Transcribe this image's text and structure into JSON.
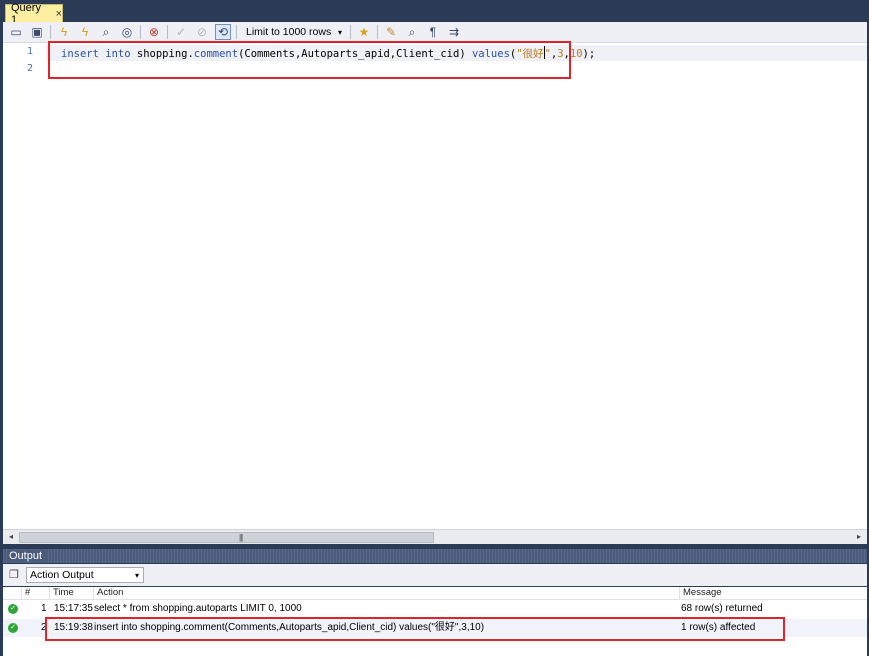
{
  "tab": {
    "title": "Query 1",
    "close": "×"
  },
  "toolbar": {
    "buttons": [
      "open-file-icon",
      "save-icon",
      "execute-icon",
      "execute-current-icon",
      "explain-icon",
      "stop-icon",
      "toggle-error-icon",
      "commit-icon",
      "rollback-icon",
      "autocommit-icon",
      "beautify-icon",
      "find-icon",
      "invisible-chars-icon",
      "wrap-icon",
      "snippet-icon"
    ],
    "limit_label": "Limit to 1000 rows",
    "limit_arrow": "▾"
  },
  "editor": {
    "line_numbers": [
      "1",
      "2"
    ],
    "line1": {
      "t1": "insert",
      "t2": "into",
      "t3": "shopping.",
      "t4": "comment",
      "t5": "(Comments,Autoparts_apid,Client_cid) ",
      "t6": "values",
      "t7": "(",
      "t8": "\"很好",
      "t9": "\"",
      "t10": ",",
      "t11": "3",
      "t12": ",",
      "t13": "10",
      "t14": ");"
    }
  },
  "scrollbar": {
    "left_arrow": "◂",
    "right_arrow": "▸",
    "grip": "|||"
  },
  "output": {
    "title": "Output",
    "view_select": "Action Output",
    "view_arrow": "▾",
    "columns": [
      "#",
      "Time",
      "Action",
      "Message"
    ],
    "rows": [
      {
        "num": "1",
        "time": "15:17:35",
        "action": "select * from shopping.autoparts LIMIT 0, 1000",
        "message": "68 row(s) returned"
      },
      {
        "num": "2",
        "time": "15:19:38",
        "action": "insert into shopping.comment(Comments,Autoparts_apid,Client_cid) values(\"很好\",3,10)",
        "message": "1 row(s) affected"
      }
    ]
  },
  "colors": {
    "frame": "#2b3a55",
    "tab": "#fcefa1",
    "highlight": "#e0242a",
    "keyword": "#2a4fb0",
    "string": "#c07a1a",
    "success": "#2fa53a"
  }
}
